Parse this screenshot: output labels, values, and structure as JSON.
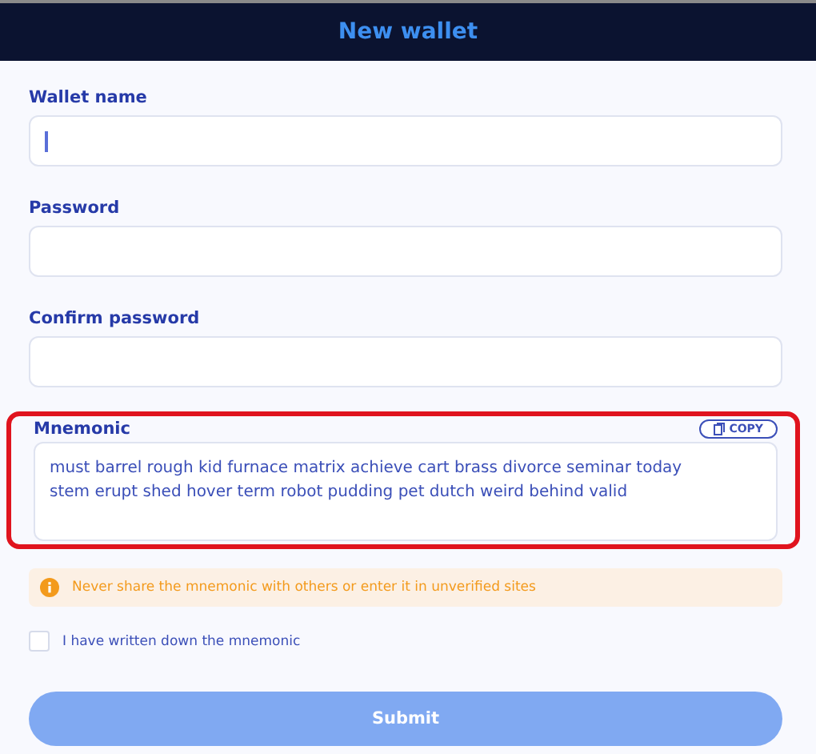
{
  "header": {
    "title": "New wallet"
  },
  "fields": [
    {
      "label": "Wallet name",
      "focused": true
    },
    {
      "label": "Password",
      "focused": false
    },
    {
      "label": "Confirm password",
      "focused": false
    }
  ],
  "mnemonic": {
    "label": "Mnemonic",
    "copy_button": "COPY",
    "value": "must barrel rough kid furnace matrix achieve cart brass divorce seminar today stem erupt shed hover term robot pudding pet dutch weird behind valid",
    "highlighted": true
  },
  "warning": "Never share the mnemonic with others or enter it in unverified sites",
  "confirm": {
    "label": "I have written down the mnemonic",
    "checked": false
  },
  "submit": {
    "label": "Submit",
    "disabled": true
  }
}
